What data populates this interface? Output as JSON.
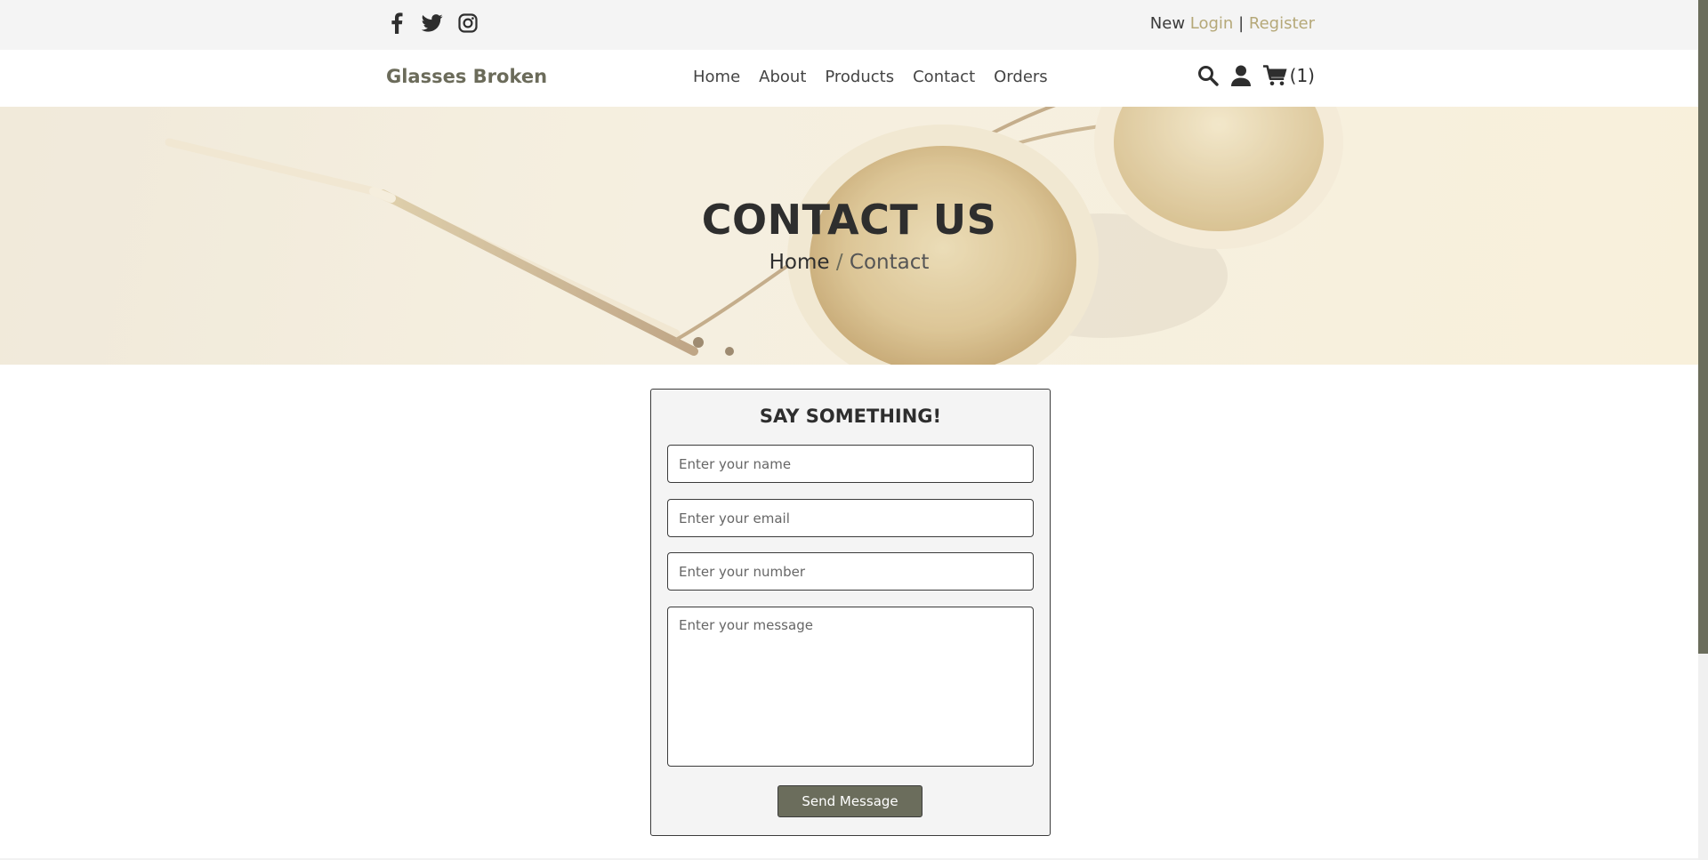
{
  "topbar": {
    "social_icons": [
      "facebook-icon",
      "twitter-icon",
      "instagram-icon"
    ],
    "auth": {
      "prefix": "New",
      "login_label": "Login",
      "separator": "|",
      "register_label": "Register"
    }
  },
  "header": {
    "brand": "Glasses Broken",
    "nav": [
      "Home",
      "About",
      "Products",
      "Contact",
      "Orders"
    ],
    "icons": [
      "search-icon",
      "user-icon",
      "cart-icon"
    ],
    "cart_count": "(1)"
  },
  "hero": {
    "title": "CONTACT US",
    "breadcrumb": {
      "home": "Home",
      "separator": " / ",
      "current": "Contact"
    }
  },
  "contact_form": {
    "heading": "SAY SOMETHING!",
    "name_placeholder": "Enter your name",
    "email_placeholder": "Enter your email",
    "number_placeholder": "Enter your number",
    "message_placeholder": "Enter your message",
    "submit_label": "Send Message"
  },
  "colors": {
    "accent": "#6b6d5c",
    "link": "#b5a878",
    "topbar_bg": "#f4f4f4",
    "form_bg": "#f4f4f4"
  }
}
